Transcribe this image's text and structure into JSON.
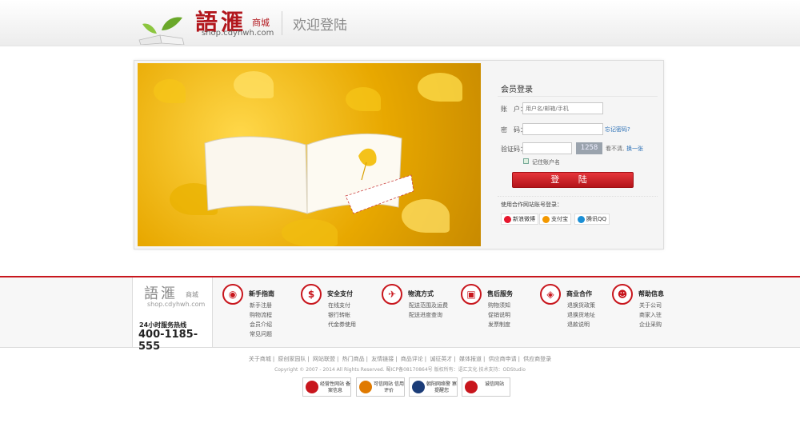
{
  "header": {
    "logo_text": "語滙",
    "logo_mall": "商城",
    "logo_url": "shop.cdyhwh.com",
    "welcome": "欢迎登陆"
  },
  "login": {
    "title": "会员登录",
    "account_label": "账　户：",
    "account_placeholder": "用户名/邮箱/手机",
    "password_label": "密　码：",
    "forgot": "忘记密码?",
    "captcha_label": "验证码：",
    "captcha_code": "1258",
    "captcha_hint": "看不清,",
    "captcha_change": "换一张",
    "remember": "记住账户名",
    "submit": "登 陆",
    "partner_title": "使用合作网站账号登录：",
    "partners": [
      {
        "name": "新浪微博",
        "color": "#e6162d"
      },
      {
        "name": "支付宝",
        "color": "#f39800"
      },
      {
        "name": "腾讯QQ",
        "color": "#1a8fd5"
      }
    ]
  },
  "footer": {
    "logo_text": "語滙",
    "logo_mall": "商城",
    "logo_url": "shop.cdyhwh.com",
    "hotline_label": "24小时服务热线",
    "hotline": "400-1185-555",
    "columns": [
      {
        "icon": "location-icon",
        "glyph": "◉",
        "title": "新手指南",
        "links": [
          "新手注册",
          "购物流程",
          "会员介绍",
          "常见问题"
        ]
      },
      {
        "icon": "dollar-icon",
        "glyph": "$",
        "title": "安全支付",
        "links": [
          "在线支付",
          "银行转帐",
          "代金券使用"
        ]
      },
      {
        "icon": "plane-icon",
        "glyph": "✈",
        "title": "物流方式",
        "links": [
          "配送范围及运费",
          "配送进度查询"
        ]
      },
      {
        "icon": "toolbox-icon",
        "glyph": "▣",
        "title": "售后服务",
        "links": [
          "购物须知",
          "促销说明",
          "发票制度"
        ]
      },
      {
        "icon": "tag-icon",
        "glyph": "◈",
        "title": "商业合作",
        "links": [
          "退换货政策",
          "退换货地址",
          "退款说明"
        ]
      },
      {
        "icon": "user-icon",
        "glyph": "☻",
        "title": "帮助信息",
        "links": [
          "关于公司",
          "商家入驻",
          "企业采购"
        ]
      }
    ],
    "bottom_links": [
      "关于商城",
      "原创家园队",
      "网站联盟",
      "热门商品",
      "友情链接",
      "商品评论",
      "诚征英才",
      "媒体报道",
      "供应商申请",
      "供应商登录"
    ],
    "copyright": "Copyright © 2007 - 2014 All Rights Reserved. 蜀ICP备08170864号  版权所有：语汇文化  技术支持：ODStudio",
    "badges": [
      {
        "text": "经营性网站 备案信息",
        "color": "#c8161d"
      },
      {
        "text": "可信网站 信用评价",
        "color": "#e07a00"
      },
      {
        "text": "朝阳网络警 察提醒您",
        "color": "#1b3c78"
      },
      {
        "text": "诚信网站",
        "color": "#c8161d"
      }
    ]
  }
}
